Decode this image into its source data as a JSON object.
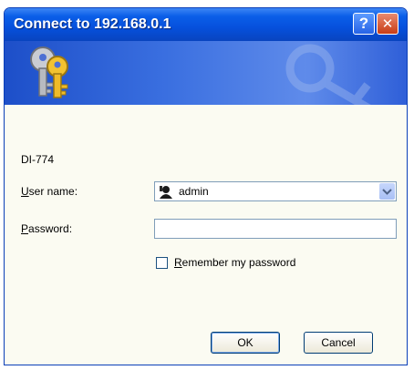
{
  "window": {
    "title": "Connect to 192.168.0.1"
  },
  "titlebar": {
    "help_label": "?",
    "close_label": "✕"
  },
  "banner": {
    "icon": "keys-icon"
  },
  "dialog": {
    "device_name": "DI-774",
    "username_label_accel": "U",
    "username_label_rest": "ser name:",
    "username_value": "admin",
    "password_label_accel": "P",
    "password_label_rest": "assword:",
    "password_value": "",
    "remember_label_accel": "R",
    "remember_label_rest": "emember my password",
    "remember_checked": false
  },
  "buttons": {
    "ok": "OK",
    "cancel": "Cancel"
  }
}
